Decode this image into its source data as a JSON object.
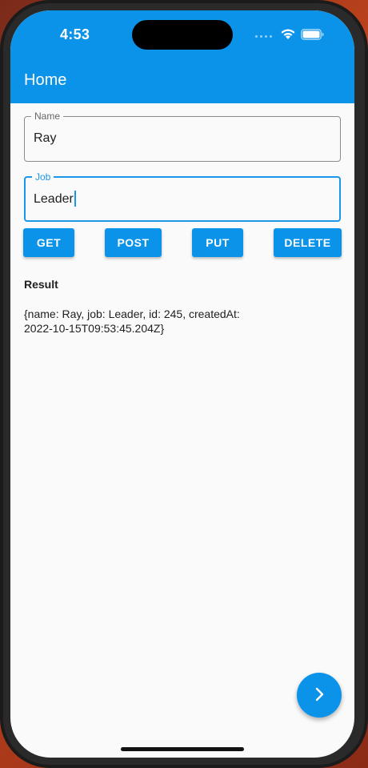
{
  "status_bar": {
    "time": "4:53"
  },
  "app_bar": {
    "title": "Home"
  },
  "form": {
    "name": {
      "label": "Name",
      "value": "Ray"
    },
    "job": {
      "label": "Job",
      "value": "Leader"
    }
  },
  "actions": {
    "get_label": "GET",
    "post_label": "POST",
    "put_label": "PUT",
    "delete_label": "DELETE"
  },
  "result": {
    "title": "Result",
    "line1": "{name: Ray, job: Leader, id: 245, createdAt:",
    "line2": "2022-10-15T09:53:45.204Z}"
  },
  "fab": {
    "icon": "chevron-right-icon"
  },
  "colors": {
    "primary": "#0b93e9",
    "focus": "#1a97e8",
    "background": "#fafafa"
  }
}
